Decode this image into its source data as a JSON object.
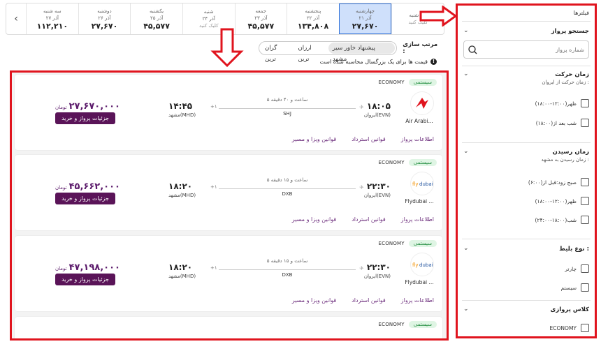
{
  "date_strip": {
    "prev_arrow": "‹",
    "days": [
      {
        "day": "سه شنبه",
        "date": "۲۷ آذر",
        "price": "۱۱۲,۲۱۰"
      },
      {
        "day": "دوشنبه",
        "date": "۲۶ آذر",
        "price": "۲۷,۶۷۰"
      },
      {
        "day": "یکشنبه",
        "date": "۲۵ آذر",
        "price": "۴۵,۵۷۷"
      },
      {
        "day": "شنبه",
        "date": "۲۴ آذر",
        "price": "کلیک کنید"
      },
      {
        "day": "جمعه",
        "date": "۲۳ آذر",
        "price": "۴۵,۵۷۷"
      },
      {
        "day": "پنجشنبه",
        "date": "۲۲ آذر",
        "price": "۱۳۴,۸۰۸"
      },
      {
        "day": "چهارشنبه",
        "date": "۲۱ آذر",
        "price": "۲۷,۶۷۰"
      },
      {
        "day": "سه شنبه",
        "date": "",
        "price": "کلیک کنید"
      }
    ]
  },
  "sort": {
    "title": "مرتب سازی :",
    "options": [
      "پیشنهاد خاور سیر مشهد",
      "ارزان ترین",
      "گران ترین"
    ]
  },
  "price_note": "قیمت ها برای یک بزرگسال محاسبه شده است",
  "flights": [
    {
      "system": "سیستمی",
      "class": "ECONOMY",
      "airline": "Air Arabi...",
      "dep_time": "۱۸:۰۵",
      "dep_city": "ایروان(EVN)",
      "arr_time": "۱۴:۴۵",
      "arr_city": "مشهد(MHD)",
      "duration": "۵ ساعت و ۴۰ دقیقه",
      "stop": "SHJ",
      "plus": "+۱",
      "price": "۲۷,۶۷۰,۰۰۰",
      "currency": "تومان",
      "button": "جزئیات پرواز و خرید",
      "links": [
        "اطلاعات پرواز",
        "قوانین استرداد",
        "قوانین ویزا و مسیر"
      ]
    },
    {
      "system": "سیستمی",
      "class": "ECONOMY",
      "airline": "Flydubai ...",
      "dep_time": "۲۲:۳۰",
      "dep_city": "ایروان(EVN)",
      "arr_time": "۱۸:۲۰",
      "arr_city": "مشهد(MHD)",
      "duration": "۵ ساعت و ۱۵ دقیقه",
      "stop": "DXB",
      "plus": "+۱",
      "price": "۴۵,۶۶۲,۰۰۰",
      "currency": "تومان",
      "button": "جزئیات پرواز و خرید",
      "links": [
        "اطلاعات پرواز",
        "قوانین استرداد",
        "قوانین ویزا و مسیر"
      ]
    },
    {
      "system": "سیستمی",
      "class": "ECONOMY",
      "airline": "Flydubai ...",
      "dep_time": "۲۲:۳۰",
      "dep_city": "ایروان(EVN)",
      "arr_time": "۱۸:۲۰",
      "arr_city": "مشهد(MHD)",
      "duration": "۵ ساعت و ۱۵ دقیقه",
      "stop": "DXB",
      "plus": "+۱",
      "price": "۴۷,۱۹۸,۰۰۰",
      "currency": "تومان",
      "button": "جزئیات پرواز و خرید",
      "links": [
        "اطلاعات پرواز",
        "قوانین استرداد",
        "قوانین ویزا و مسیر"
      ]
    },
    {
      "system": "سیستمی",
      "class": "ECONOMY"
    }
  ],
  "filters": {
    "title": "فیلترها",
    "search_section": {
      "title": "جستجو پرواز",
      "placeholder": "شماره پرواز"
    },
    "departure": {
      "title": "زمان حرکت",
      "subtitle": "زمان حرکت از ایروان :",
      "options": [
        "ظهر(۱۲:۰۰-۱۸:۰۰)",
        "شب بعد از(۱۸:۰۰)"
      ]
    },
    "arrival": {
      "title": "زمان رسیدن",
      "subtitle": "زمان رسیدن به مشهد :",
      "options": [
        "صبح زود:قبل از(۶:۰۰)",
        "ظهر(۱۲:۰۰-۱۸:۰۰)",
        "شب(۱۸:۰۰-۲۴:۰۰)"
      ]
    },
    "ticket_type": {
      "title": "نوع بلیط :",
      "options": [
        "چارتر",
        "سیستم"
      ]
    },
    "cabin_class": {
      "title": "کلاس پروازی",
      "options": [
        "ECONOMY"
      ]
    }
  },
  "colors": {
    "highlight_red": "#e0141e",
    "primary_purple": "#5a1458",
    "active_date": "#cfe0fb"
  }
}
